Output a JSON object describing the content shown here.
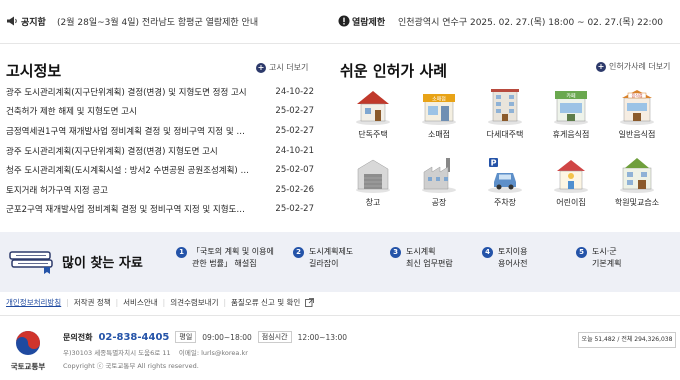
{
  "notice_bar": {
    "announce_label": "공지함",
    "announce_text": "(2월 28일~3월 4일) 전라남도 함평군 열람제한 안내",
    "restrict_label": "열람제한",
    "restrict_text": "인천광역시 연수구 2025. 02. 27.(목) 18:00 ~ 02. 27.(목) 22:00"
  },
  "notices": {
    "title": "고시정보",
    "more_label": "고시 더보기",
    "items": [
      {
        "title": "광주 도시관리계획(지구단위계획) 결정(변경) 및 지형도면 정정 고시",
        "date": "24-10-22"
      },
      {
        "title": "건축허가 제한 해제 및 지형도면 고시",
        "date": "25-02-27"
      },
      {
        "title": "금정역세권1구역 재개발사업 정비계획 결정 및 정비구역 지정 및 …",
        "date": "25-02-27"
      },
      {
        "title": "광주 도시관리계획(지구단위계획) 결정(변경) 지형도면 고시",
        "date": "24-10-21"
      },
      {
        "title": "청주 도시관리계획(도시계획시설 : 방서2 수변공원 공원조성계획) …",
        "date": "25-02-07"
      },
      {
        "title": "토지거래 허가구역 지정 공고",
        "date": "25-02-26"
      },
      {
        "title": "군포2구역 재개발사업 정비계획 결정 및 정비구역 지정 및 지형도…",
        "date": "25-02-27"
      }
    ]
  },
  "cases": {
    "title": "쉬운 인허가 사례",
    "more_label": "인허가사례 더보기",
    "items": [
      {
        "label": "단독주택",
        "icon": "house-icon"
      },
      {
        "label": "소매점",
        "icon": "store-icon"
      },
      {
        "label": "다세대주택",
        "icon": "apartment-icon"
      },
      {
        "label": "휴게음식점",
        "icon": "cafe-icon"
      },
      {
        "label": "일반음식점",
        "icon": "restaurant-icon"
      },
      {
        "label": "창고",
        "icon": "warehouse-icon"
      },
      {
        "label": "공장",
        "icon": "factory-icon"
      },
      {
        "label": "주차장",
        "icon": "parking-icon"
      },
      {
        "label": "어린이집",
        "icon": "daycare-icon"
      },
      {
        "label": "학원및교습소",
        "icon": "academy-icon"
      }
    ],
    "signs": {
      "store": "소매점",
      "cafe": "카페",
      "restaurant": "음식점"
    }
  },
  "frequent": {
    "title": "많이 찾는 자료",
    "items": [
      {
        "num": "1",
        "line1": "「국토의 계획 및 이용에",
        "line2": "관한 법률」 해설집"
      },
      {
        "num": "2",
        "line1": "도시계획제도",
        "line2": "길라잡이"
      },
      {
        "num": "3",
        "line1": "도시계획",
        "line2": "최신 업무편람"
      },
      {
        "num": "4",
        "line1": "토지이용",
        "line2": "용어사전"
      },
      {
        "num": "5",
        "line1": "도시·군",
        "line2": "기본계획"
      }
    ]
  },
  "footer_links": [
    "개인정보처리방침",
    "저작권 정책",
    "서비스안내",
    "의견수렴보내기",
    "품질오류 신고 및 확인"
  ],
  "footer": {
    "logo_text": "국토교통부",
    "contact_label": "문의전화",
    "phone": "02-838-4405",
    "weekday_label": "평일",
    "weekday_hours": "09:00~18:00",
    "lunch_label": "점심시간",
    "lunch_hours": "12:00~13:00",
    "address": "우)30103 세종특별자치시 도움6로 11",
    "email": "이메일: lurls@korea.kr",
    "copyright": "Copyright ⓒ 국토교통부 All rights reserved.",
    "visits": "오늘 51,482 / 전체 294,326,038"
  },
  "colors": {
    "accent": "#2453a8",
    "dark_navy": "#2d3a6b",
    "band_bg": "#eef0f6"
  }
}
